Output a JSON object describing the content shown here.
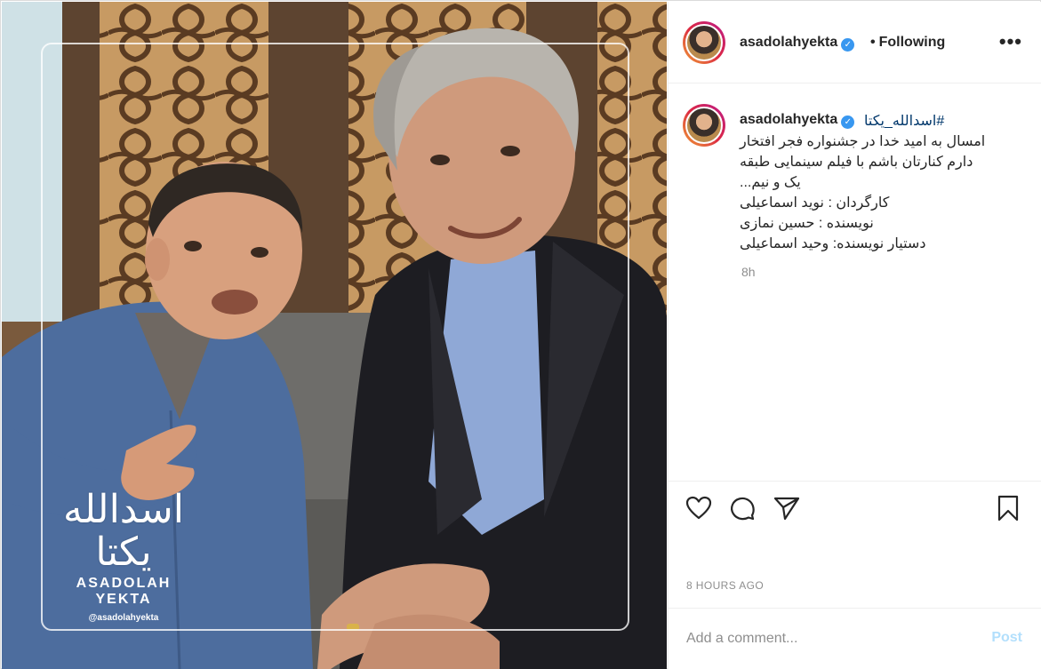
{
  "post": {
    "username": "asadolahyekta",
    "follow_status": "Following",
    "dot_separator": "•",
    "more_icon": "more-horizontal-icon",
    "verified_icon": "verified-badge-icon"
  },
  "caption": {
    "username": "asadolahyekta",
    "hashtag": "#اسدالله_یکتا",
    "lines": [
      "امسال به امید خدا در جشنواره فجر افتخار",
      "دارم کنارتان باشم با فیلم سینمایی طبقه",
      "یک و نیم...",
      "کارگردان : نوید اسماعیلی",
      "نویسنده : حسین نمازی",
      "دستیار نویسنده: وحید اسماعیلی"
    ],
    "age": "8h"
  },
  "actions": {
    "like_icon": "heart-icon",
    "comment_icon": "comment-icon",
    "share_icon": "send-icon",
    "save_icon": "bookmark-icon"
  },
  "timestamp": "8 HOURS AGO",
  "comment": {
    "placeholder": "Add a comment...",
    "post_label": "Post"
  },
  "watermark": {
    "latin": "ASADOLAH YEKTA",
    "handle": "@asadolahyekta"
  },
  "colors": {
    "link_blue": "#00376b",
    "verified_blue": "#3897f0",
    "post_button_disabled": "#b2dffc",
    "muted_text": "#8e8e8e",
    "border": "#dbdbdb"
  }
}
